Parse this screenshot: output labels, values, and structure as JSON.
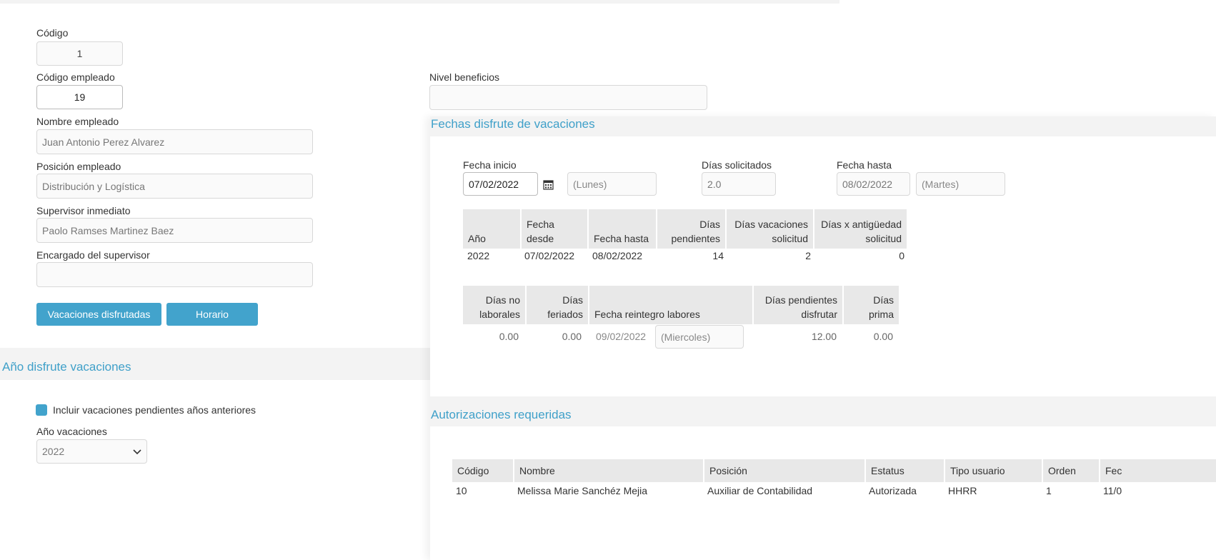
{
  "form": {
    "codigo": {
      "label": "Código",
      "value": "1"
    },
    "codigo_empleado": {
      "label": "Código empleado",
      "value": "19"
    },
    "nombre_empleado": {
      "label": "Nombre empleado",
      "value": "Juan Antonio Perez Alvarez"
    },
    "posicion_empleado": {
      "label": "Posición empleado",
      "value": "Distribución y Logística"
    },
    "supervisor": {
      "label": "Supervisor inmediato",
      "value": "Paolo Ramses Martinez Baez"
    },
    "encargado": {
      "label": "Encargado del supervisor",
      "value": ""
    },
    "nivel_beneficios": {
      "label": "Nivel beneficios",
      "value": ""
    },
    "buttons": {
      "vacaciones": "Vacaciones disfrutadas",
      "horario": "Horario"
    }
  },
  "anio_section": {
    "title": "Año disfrute vacaciones",
    "checkbox_label": "Incluir vacaciones pendientes años anteriores",
    "checkbox_checked": true,
    "anio_label": "Año vacaciones",
    "anio_value": "2022"
  },
  "fechas_section": {
    "title": "Fechas disfrute de vacaciones",
    "fecha_inicio": {
      "label": "Fecha inicio",
      "value": "07/02/2022",
      "day": "(Lunes)"
    },
    "dias_solicitados": {
      "label": "Días solicitados",
      "value": "2.0"
    },
    "fecha_hasta": {
      "label": "Fecha hasta",
      "value": "08/02/2022",
      "day": "(Martes)"
    },
    "table1": {
      "headers": [
        "Año",
        "Fecha desde",
        "Fecha hasta",
        "Días pendientes",
        "Días vacaciones solicitud",
        "Días x antigüedad solicitud"
      ],
      "row": [
        "2022",
        "07/02/2022",
        "08/02/2022",
        "14",
        "2",
        "0"
      ]
    },
    "table2": {
      "headers": [
        "Días no laborales",
        "Días feriados",
        "Fecha reintegro labores",
        "Días pendientes disfrutar",
        "Días prima"
      ],
      "row": {
        "no_laborales": "0.00",
        "feriados": "0.00",
        "reintegro_fecha": "09/02/2022",
        "reintegro_dia": "(Miercoles)",
        "pendientes": "12.00",
        "prima": "0.00"
      }
    }
  },
  "autorizaciones": {
    "title": "Autorizaciones requeridas",
    "headers": [
      "Código",
      "Nombre",
      "Posición",
      "Estatus",
      "Tipo usuario",
      "Orden",
      "Fec"
    ],
    "row": [
      "10",
      "Melissa Marie Sanchéz Mejia",
      "Auxiliar de Contabilidad",
      "Autorizada",
      "HHRR",
      "1",
      "11/0"
    ]
  },
  "colors": {
    "accent": "#42a3cc",
    "title": "#3fa0c9",
    "band": "#f3f3f3",
    "header": "#e8e8e8"
  },
  "icons": {
    "calendar": "calendar-icon",
    "chevron": "chevron-down-icon"
  }
}
